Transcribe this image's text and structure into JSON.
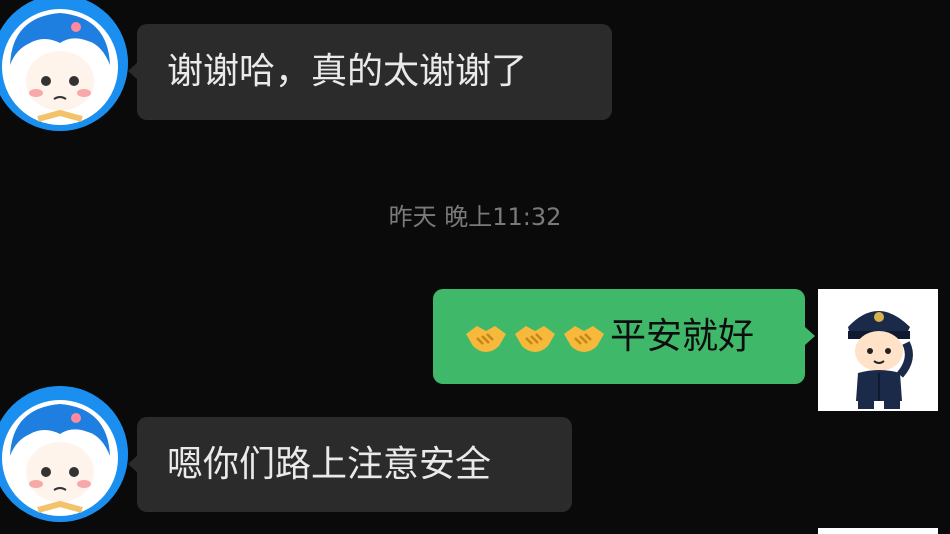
{
  "messages": [
    {
      "side": "in",
      "text": "谢谢哈，真的太谢谢了"
    },
    {
      "side": "out",
      "emoji": [
        "handshake-emoji",
        "handshake-emoji",
        "handshake-emoji"
      ],
      "text": "平安就好"
    },
    {
      "side": "in",
      "text": "嗯你们路上注意安全"
    }
  ],
  "timestamp": "昨天 晚上11:32",
  "colors": {
    "background": "#0a0a0a",
    "incoming_bubble": "#2b2b2b",
    "outgoing_bubble": "#3fb86a",
    "avatar_ring": "#1a8ff0"
  }
}
